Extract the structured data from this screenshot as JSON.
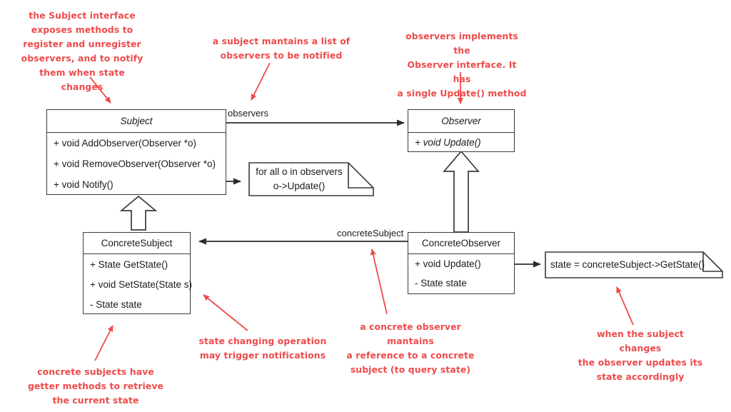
{
  "diagram": {
    "title": "Observer Design Pattern UML Class Diagram",
    "accent_color": "#ee4b4b",
    "line_color": "#3a3a3a"
  },
  "classes": {
    "subject": {
      "name": "Subject",
      "is_abstract": true,
      "members": [
        "+ void AddObserver(Observer *o)",
        "+ void RemoveObserver(Observer *o)",
        "+ void Notify()"
      ]
    },
    "observer": {
      "name": "Observer",
      "is_abstract": true,
      "members": [
        "+ void Update()"
      ]
    },
    "concrete_subject": {
      "name": "ConcreteSubject",
      "is_abstract": false,
      "members": [
        "+ State GetState()",
        "+ void SetState(State s)",
        "- State state"
      ]
    },
    "concrete_observer": {
      "name": "ConcreteObserver",
      "is_abstract": false,
      "members": [
        "+ void Update()",
        "- State state"
      ]
    }
  },
  "notes": {
    "notify_body": {
      "line1": "for all o in observers",
      "line2": "o->Update()"
    },
    "update_body": {
      "line1": "state = concreteSubject->GetState()"
    }
  },
  "edge_labels": {
    "observers": "observers",
    "concrete_subject": "concreteSubject"
  },
  "annotations": [
    {
      "id": "subject-interface",
      "text": "the Subject interface\nexposes methods to\nregister and unregister\nobservers, and to notify\nthem when state changes"
    },
    {
      "id": "subject-maintains-list",
      "text": "a subject mantains a list of\nobservers to be notified"
    },
    {
      "id": "observers-implement",
      "text": "observers implements the\nObserver interface. It has\na single Update() method"
    },
    {
      "id": "concrete-subject-getters",
      "text": "concrete subjects have\ngetter methods to retrieve\nthe current state"
    },
    {
      "id": "state-changing-operation",
      "text": "state changing operation\nmay trigger notifications"
    },
    {
      "id": "concrete-observer-reference",
      "text": "a concrete observer mantains\na reference to a concrete\nsubject (to query state)"
    },
    {
      "id": "observer-updates-state",
      "text": "when the subject changes\nthe observer updates its\nstate accordingly"
    }
  ]
}
